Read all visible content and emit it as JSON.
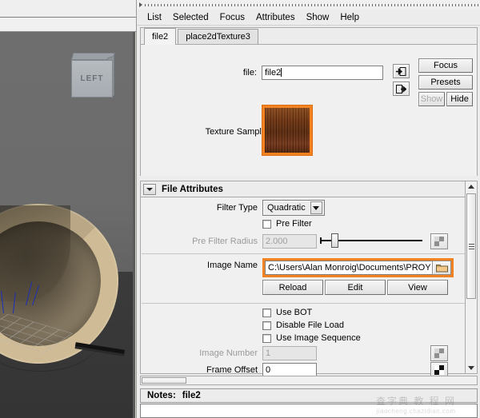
{
  "viewport": {
    "view_cube_label": "LEFT",
    "background_color": "#6a6a6a",
    "model_color": "#cfbb95",
    "normals_color": "#1a2fb8"
  },
  "menubar": {
    "items": [
      "List",
      "Selected",
      "Focus",
      "Attributes",
      "Show",
      "Help"
    ]
  },
  "tabs": [
    {
      "label": "file2",
      "active": true
    },
    {
      "label": "place2dTexture3",
      "active": false
    }
  ],
  "file_row": {
    "label": "file:",
    "value": "file2",
    "input_icon": "input-connection-icon",
    "output_icon": "output-connection-icon"
  },
  "side_buttons": {
    "focus": "Focus",
    "presets": "Presets",
    "show": "Show",
    "show_disabled": true,
    "hide": "Hide"
  },
  "texture_sample": {
    "label": "Texture Sample",
    "selection_color": "#f58220"
  },
  "file_attributes": {
    "section_title": "File Attributes",
    "filter_type": {
      "label": "Filter Type",
      "value": "Quadratic"
    },
    "pre_filter": {
      "label": "Pre Filter",
      "checked": false
    },
    "pre_filter_radius": {
      "label": "Pre Filter Radius",
      "value": "2.000",
      "disabled": true,
      "slider_percent": 7
    },
    "image_name": {
      "label": "Image Name",
      "value": "C:\\Users\\Alan Monroig\\Documents\\PROY",
      "highlight_color": "#f58220",
      "browse_icon": "folder-icon"
    },
    "image_buttons": [
      "Reload",
      "Edit",
      "View"
    ],
    "checkboxes": [
      {
        "label": "Use BOT",
        "checked": false
      },
      {
        "label": "Disable File Load",
        "checked": false
      },
      {
        "label": "Use Image Sequence",
        "checked": false
      }
    ],
    "image_number": {
      "label": "Image Number",
      "value": "1",
      "disabled": true
    },
    "frame_offset": {
      "label": "Frame Offset",
      "value": "0",
      "disabled": false
    }
  },
  "notes": {
    "label": "Notes:",
    "value": "file2",
    "body": ""
  },
  "watermark": {
    "top": "查字典 教 程 网",
    "bottom": "jiaocheng.chazidian.com"
  }
}
